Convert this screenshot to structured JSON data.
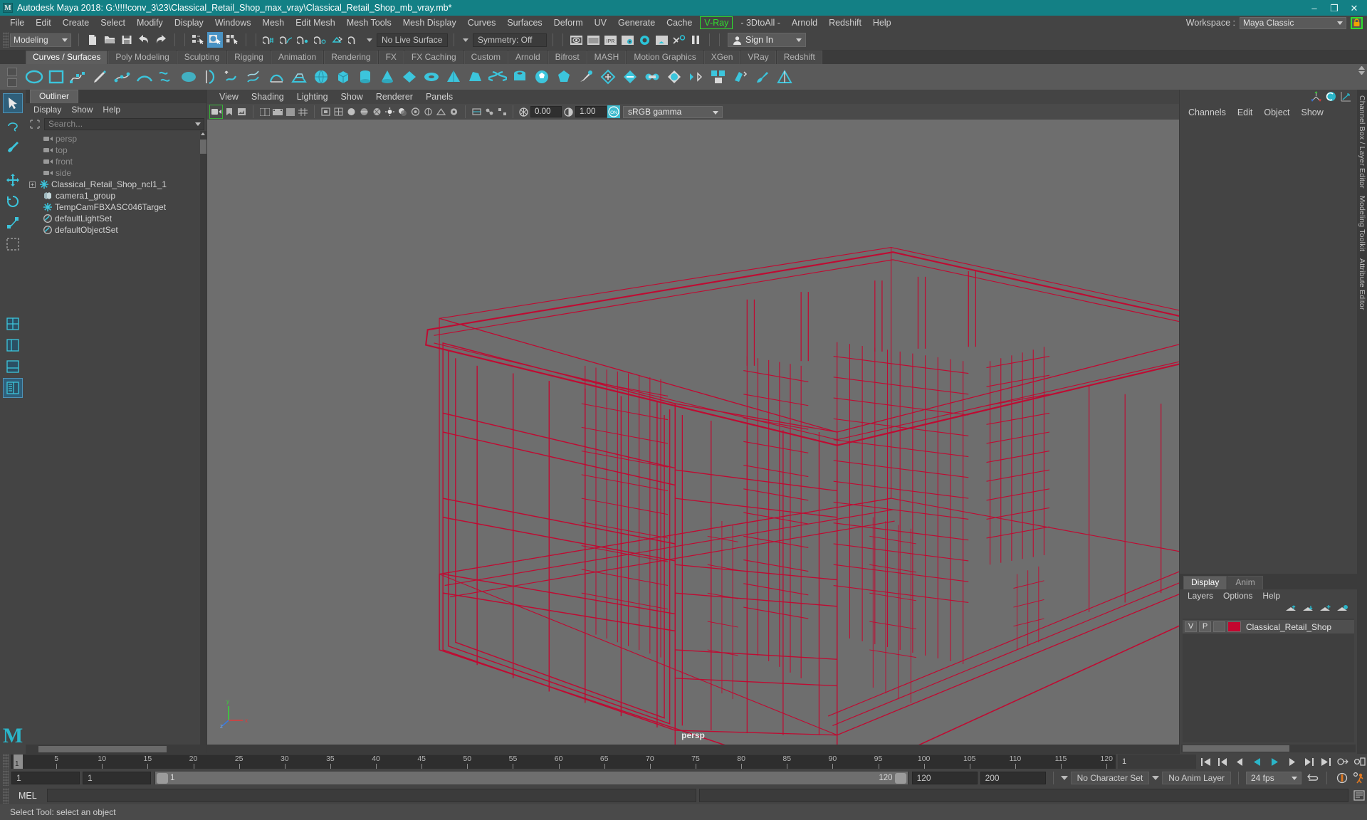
{
  "titlebar": {
    "app_title": "Autodesk Maya 2018: G:\\!!!!conv_3\\23\\Classical_Retail_Shop_max_vray\\Classical_Retail_Shop_mb_vray.mb*",
    "logo_text": "M",
    "minimize": "–",
    "maximize": "❐",
    "close": "✕",
    "bg_color": "#138085"
  },
  "menubar": {
    "items": [
      {
        "label": "File"
      },
      {
        "label": "Edit"
      },
      {
        "label": "Create"
      },
      {
        "label": "Select"
      },
      {
        "label": "Modify"
      },
      {
        "label": "Display"
      },
      {
        "label": "Windows"
      },
      {
        "label": "Mesh"
      },
      {
        "label": "Edit Mesh"
      },
      {
        "label": "Mesh Tools"
      },
      {
        "label": "Mesh Display"
      },
      {
        "label": "Curves"
      },
      {
        "label": "Surfaces"
      },
      {
        "label": "Deform"
      },
      {
        "label": "UV"
      },
      {
        "label": "Generate"
      },
      {
        "label": "Cache"
      },
      {
        "label": "V-Ray",
        "highlight": true
      },
      {
        "label": "- 3DtoAll -"
      },
      {
        "label": "Arnold"
      },
      {
        "label": "Redshift"
      },
      {
        "label": "Help"
      }
    ],
    "highlight_color": "#2ee02e",
    "workspace_label": "Workspace :",
    "workspace_value": "Maya Classic"
  },
  "statusline": {
    "menuset_value": "Modeling",
    "live_surface": "No Live Surface",
    "symmetry": "Symmetry: Off",
    "signin_label": "Sign In",
    "ipr_label": "IPR"
  },
  "shelf": {
    "tabs": [
      {
        "label": "Curves / Surfaces",
        "active": true
      },
      {
        "label": "Poly Modeling"
      },
      {
        "label": "Sculpting"
      },
      {
        "label": "Rigging"
      },
      {
        "label": "Animation"
      },
      {
        "label": "Rendering"
      },
      {
        "label": "FX"
      },
      {
        "label": "FX Caching"
      },
      {
        "label": "Custom"
      },
      {
        "label": "Arnold"
      },
      {
        "label": "Bifrost"
      },
      {
        "label": "MASH"
      },
      {
        "label": "Motion Graphics"
      },
      {
        "label": "XGen"
      },
      {
        "label": "VRay"
      },
      {
        "label": "Redshift"
      }
    ]
  },
  "outliner": {
    "tab_label": "Outliner",
    "menus": [
      "Display",
      "Show",
      "Help"
    ],
    "search_placeholder": "Search...",
    "items": [
      {
        "label": "persp",
        "icon": "camera-icon",
        "dim": true,
        "expandable": false
      },
      {
        "label": "top",
        "icon": "camera-icon",
        "dim": true,
        "expandable": false
      },
      {
        "label": "front",
        "icon": "camera-icon",
        "dim": true,
        "expandable": false
      },
      {
        "label": "side",
        "icon": "camera-icon",
        "dim": true,
        "expandable": false
      },
      {
        "label": "Classical_Retail_Shop_ncl1_1",
        "icon": "transform-icon",
        "dim": false,
        "expandable": true
      },
      {
        "label": "camera1_group",
        "icon": "group-icon",
        "dim": false,
        "expandable": false
      },
      {
        "label": "TempCamFBXASC046Target",
        "icon": "transform-icon",
        "dim": false,
        "expandable": false
      },
      {
        "label": "defaultLightSet",
        "icon": "set-icon",
        "dim": false,
        "expandable": false
      },
      {
        "label": "defaultObjectSet",
        "icon": "set-icon",
        "dim": false,
        "expandable": false
      }
    ]
  },
  "viewport": {
    "menus": [
      "View",
      "Shading",
      "Lighting",
      "Show",
      "Renderer",
      "Panels"
    ],
    "exposure_value": "0.00",
    "gamma_value": "1.00",
    "color_management": "sRGB gamma",
    "toggle_on_label": "ON",
    "camera_label": "persp",
    "background_color": "#6e6e6e",
    "wireframe_color": "#c4062f",
    "axis_labels": {
      "x": "x",
      "y": "y",
      "z": "z"
    }
  },
  "right_panel": {
    "menus": [
      "Channels",
      "Edit",
      "Object",
      "Show"
    ],
    "vertical_tabs": [
      "Channel Box / Layer Editor",
      "Modeling Toolkit",
      "Attribute Editor"
    ]
  },
  "layers": {
    "tabs": [
      {
        "label": "Display",
        "active": true
      },
      {
        "label": "Anim",
        "active": false
      }
    ],
    "menus": [
      "Layers",
      "Options",
      "Help"
    ],
    "rows": [
      {
        "visibility": "V",
        "playback": "P",
        "third": "",
        "color": "#c4062f",
        "name": "Classical_Retail_Shop"
      }
    ]
  },
  "timeslider": {
    "current_frame": "1",
    "ticks": [
      5,
      10,
      15,
      20,
      25,
      30,
      35,
      40,
      45,
      50,
      55,
      60,
      65,
      70,
      75,
      80,
      85,
      90,
      95,
      100,
      105,
      110,
      115,
      120
    ],
    "end_field": "1"
  },
  "rangeslider": {
    "start_field": "1",
    "start_field2": "1",
    "range_start": "1",
    "range_end": "120",
    "anim_start": "120",
    "anim_end": "200",
    "character_set": "No Character Set",
    "anim_layer": "No Anim Layer",
    "fps": "24 fps"
  },
  "command_line": {
    "mel_label": "MEL",
    "mel_value": "",
    "status_message": "Select Tool: select an object"
  }
}
